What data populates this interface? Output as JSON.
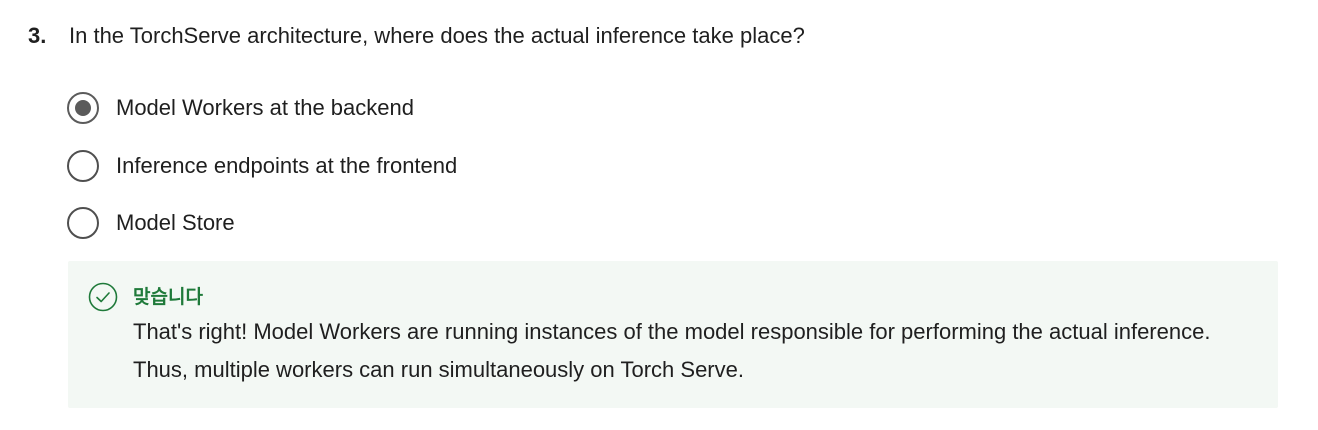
{
  "question": {
    "number": "3.",
    "text": "In the TorchServe architecture, where does the actual inference take place?"
  },
  "options": [
    {
      "label": "Model Workers at the backend",
      "selected": true
    },
    {
      "label": "Inference endpoints at the frontend",
      "selected": false
    },
    {
      "label": "Model Store",
      "selected": false
    }
  ],
  "feedback": {
    "icon": "check-circle-icon",
    "title": "맞습니다",
    "text": "That's right! Model Workers are running instances of the model responsible for performing the actual inference. Thus, multiple workers can run simultaneously on Torch Serve.",
    "accent_color": "#1f7a3a",
    "background_color": "#f3f8f4"
  }
}
